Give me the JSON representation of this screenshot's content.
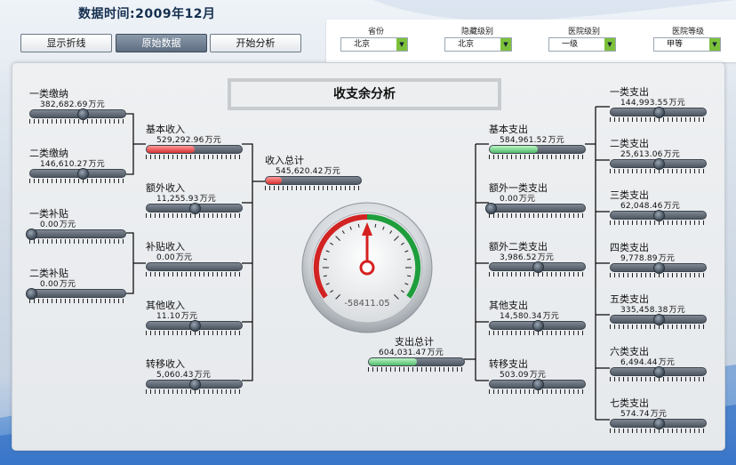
{
  "header": {
    "data_time": "数据时间:2009年12月"
  },
  "buttons": {
    "show_trend": "显示折线",
    "raw_data": "原始数据",
    "start_analysis": "开始分析"
  },
  "filters": [
    {
      "label": "省份",
      "value": "北京"
    },
    {
      "label": "隐藏级别",
      "value": "北京"
    },
    {
      "label": "医院级别",
      "value": "一级"
    },
    {
      "label": "医院等级",
      "value": "甲等"
    }
  ],
  "title": "收支余分析",
  "gauge_value": "-58411.05",
  "unit": "万元",
  "left_sources": [
    {
      "label": "一类缴纳",
      "value": "382,682.69",
      "level": 0.55
    },
    {
      "label": "二类缴纳",
      "value": "146,610.27",
      "level": 0.55
    },
    {
      "label": "一类补贴",
      "value": "0.00",
      "level": 0
    },
    {
      "label": "二类补贴",
      "value": "0.00",
      "level": 0
    }
  ],
  "income": [
    {
      "label": "基本收入",
      "value": "529,292.96",
      "level": 0.5,
      "fill": "red"
    },
    {
      "label": "额外收入",
      "value": "11,255.93",
      "level": 0.5
    },
    {
      "label": "补贴收入",
      "value": "0.00",
      "level": 0
    },
    {
      "label": "其他收入",
      "value": "11.10",
      "level": 0.5
    },
    {
      "label": "转移收入",
      "value": "5,060.43",
      "level": 0.5
    }
  ],
  "income_total": {
    "label": "收入总计",
    "value": "545,620.42",
    "level": 0.17,
    "fill": "red"
  },
  "expense_total": {
    "label": "支出总计",
    "value": "604,031.47",
    "level": 0.5,
    "fill": "green"
  },
  "expenses": [
    {
      "label": "基本支出",
      "value": "584,961.52",
      "level": 0.5,
      "fill": "green"
    },
    {
      "label": "额外一类支出",
      "value": "0.00",
      "level": 0
    },
    {
      "label": "额外二类支出",
      "value": "3,986.52",
      "level": 0.5
    },
    {
      "label": "其他支出",
      "value": "14,580.34",
      "level": 0.5
    },
    {
      "label": "转移支出",
      "value": "503.09",
      "level": 0.5
    }
  ],
  "expense_types": [
    {
      "label": "一类支出",
      "value": "144,993.55",
      "level": 0.5
    },
    {
      "label": "二类支出",
      "value": "25,613.06",
      "level": 0.5
    },
    {
      "label": "三类支出",
      "value": "62,048.46",
      "level": 0.5
    },
    {
      "label": "四类支出",
      "value": "9,778.89",
      "level": 0.5
    },
    {
      "label": "五类支出",
      "value": "335,458.38",
      "level": 0.5
    },
    {
      "label": "六类支出",
      "value": "6,494.44",
      "level": 0.5
    },
    {
      "label": "七类支出",
      "value": "574.74",
      "level": 0.5
    }
  ],
  "colors": {
    "red": "#d83131",
    "green": "#4fbb6a",
    "lime": "#7cc13b"
  }
}
